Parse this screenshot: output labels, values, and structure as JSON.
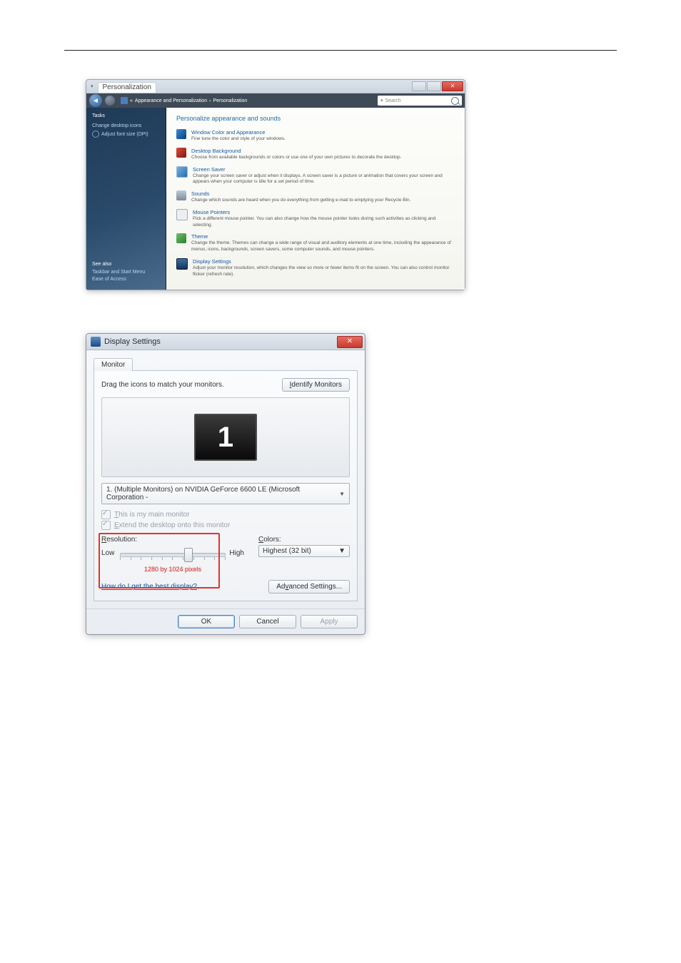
{
  "win1": {
    "title_tab": "Personalization",
    "breadcrumb": {
      "seg1": "Appearance and Personalization",
      "seg2": "Personalization"
    },
    "search_placeholder": "Search",
    "sidebar": {
      "tasks_header": "Tasks",
      "links": [
        {
          "label": "Change desktop icons"
        },
        {
          "label": "Adjust font size (DPI)"
        }
      ],
      "see_also_header": "See also",
      "see_also": [
        {
          "label": "Taskbar and Start Menu"
        },
        {
          "label": "Ease of Access"
        }
      ]
    },
    "main_header": "Personalize appearance and sounds",
    "items": [
      {
        "title": "Window Color and Appearance",
        "desc": "Fine tune the color and style of your windows."
      },
      {
        "title": "Desktop Background",
        "desc": "Choose from available backgrounds or colors or use one of your own pictures to decorate the desktop."
      },
      {
        "title": "Screen Saver",
        "desc": "Change your screen saver or adjust when it displays. A screen saver is a picture or animation that covers your screen and appears when your computer is idle for a set period of time."
      },
      {
        "title": "Sounds",
        "desc": "Change which sounds are heard when you do everything from getting e-mail to emptying your Recycle Bin."
      },
      {
        "title": "Mouse Pointers",
        "desc": "Pick a different mouse pointer. You can also change how the mouse pointer looks during such activities as clicking and selecting."
      },
      {
        "title": "Theme",
        "desc": "Change the theme. Themes can change a wide range of visual and auditory elements at one time, including the appearance of menus, icons, backgrounds, screen savers, some computer sounds, and mouse pointers."
      },
      {
        "title": "Display Settings",
        "desc": "Adjust your monitor resolution, which changes the view so more or fewer items fit on the screen. You can also control monitor flicker (refresh rate)."
      }
    ]
  },
  "win2": {
    "title": "Display Settings",
    "tab": "Monitor",
    "instruction": "Drag the icons to match your monitors.",
    "identify_btn": "Identify Monitors",
    "monitor_number": "1",
    "monitor_dropdown": "1. (Multiple Monitors) on NVIDIA GeForce 6600 LE (Microsoft Corporation -",
    "chk_main": "This is my main monitor",
    "chk_extend": "Extend the desktop onto this monitor",
    "resolution_label": "Resolution:",
    "low": "Low",
    "high": "High",
    "res_readout": "1280 by 1024 pixels",
    "colors_label": "Colors:",
    "colors_value": "Highest (32 bit)",
    "help_link": "How do I get the best display?",
    "advanced_btn": "Advanced Settings...",
    "ok": "OK",
    "cancel": "Cancel",
    "apply": "Apply"
  }
}
